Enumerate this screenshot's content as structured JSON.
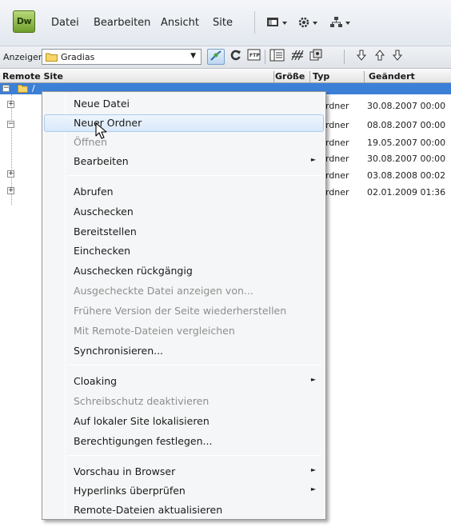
{
  "app": {
    "logo_text": "Dw",
    "accent_color": "#7aab32"
  },
  "menubar": {
    "items": [
      "Datei",
      "Bearbeiten",
      "Ansicht",
      "Site"
    ],
    "icons": [
      "layout-icon",
      "gear-icon",
      "site-structure-icon"
    ]
  },
  "toolbar": {
    "anzeigen_label": "Anzeigen:",
    "site_select_value": "Gradias",
    "buttons": [
      "connect-icon",
      "refresh-icon",
      "ftp-log-icon",
      "site-files-view-icon",
      "testing-server-icon",
      "repository-icon",
      "get-icon",
      "put-icon",
      "checkout-icon"
    ]
  },
  "columns": {
    "name": "Remote Site",
    "size": "Größe",
    "type": "Typ",
    "modified": "Geändert"
  },
  "rows": [
    {
      "type": "rdner",
      "date": "30.08.2007 00:00"
    },
    {
      "type": "rdner",
      "date": "08.08.2007 00:00"
    },
    {
      "type": "rdner",
      "date": "19.05.2007 00:00"
    },
    {
      "type": "rdner",
      "date": "30.08.2007 00:00"
    },
    {
      "type": "rdner",
      "date": "03.08.2008 00:02"
    },
    {
      "type": "rdner",
      "date": "02.01.2009 01:36"
    }
  ],
  "root_label": "/",
  "context_menu": {
    "items": [
      {
        "label": "Neue Datei",
        "disabled": false
      },
      {
        "label": "Neuer Ordner",
        "disabled": false,
        "hover": true
      },
      {
        "label": "Öffnen",
        "disabled": true
      },
      {
        "label": "Bearbeiten",
        "disabled": false,
        "submenu": true
      },
      {
        "label": "Abrufen",
        "disabled": false
      },
      {
        "label": "Auschecken",
        "disabled": false
      },
      {
        "label": "Bereitstellen",
        "disabled": false
      },
      {
        "label": "Einchecken",
        "disabled": false
      },
      {
        "label": "Auschecken rückgängig",
        "disabled": false
      },
      {
        "label": "Ausgecheckte Datei anzeigen von...",
        "disabled": true
      },
      {
        "label": "Frühere Version der Seite wiederherstellen",
        "disabled": true
      },
      {
        "label": "Mit Remote-Dateien vergleichen",
        "disabled": true
      },
      {
        "label": "Synchronisieren...",
        "disabled": false
      },
      {
        "label": "Cloaking",
        "disabled": false,
        "submenu": true
      },
      {
        "label": "Schreibschutz deaktivieren",
        "disabled": true
      },
      {
        "label": "Auf lokaler Site lokalisieren",
        "disabled": false
      },
      {
        "label": "Berechtigungen festlegen...",
        "disabled": false
      },
      {
        "label": "Vorschau in Browser",
        "disabled": false,
        "submenu": true
      },
      {
        "label": "Hyperlinks überprüfen",
        "disabled": false,
        "submenu": true
      },
      {
        "label": "Remote-Dateien aktualisieren",
        "disabled": false
      }
    ]
  }
}
